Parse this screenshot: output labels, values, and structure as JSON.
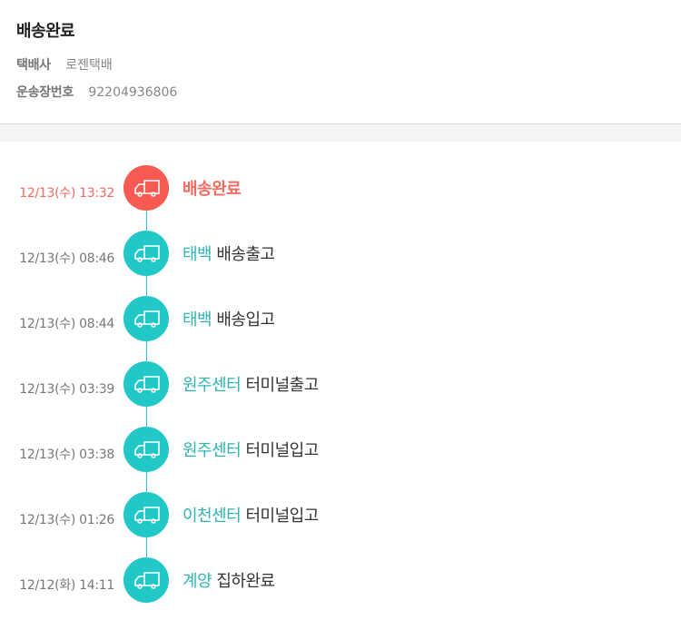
{
  "header": {
    "status_title": "배송완료",
    "courier_label": "택배사",
    "courier_value": "로젠택배",
    "tracking_label": "운송장번호",
    "tracking_value": "92204936806"
  },
  "events": [
    {
      "time": "12/13(수) 13:32",
      "location": "배송완료",
      "desc": "",
      "active": true
    },
    {
      "time": "12/13(수) 08:46",
      "location": "태백",
      "desc": "배송출고",
      "active": false
    },
    {
      "time": "12/13(수) 08:44",
      "location": "태백",
      "desc": "배송입고",
      "active": false
    },
    {
      "time": "12/13(수) 03:39",
      "location": "원주센터",
      "desc": "터미널출고",
      "active": false
    },
    {
      "time": "12/13(수) 03:38",
      "location": "원주센터",
      "desc": "터미널입고",
      "active": false
    },
    {
      "time": "12/13(수) 01:26",
      "location": "이천센터",
      "desc": "터미널입고",
      "active": false
    },
    {
      "time": "12/12(화) 14:11",
      "location": "계양",
      "desc": "집하완료",
      "active": false
    }
  ],
  "icons": {
    "event_icon": "truck-icon"
  },
  "colors": {
    "active": "#f65a50",
    "inactive": "#22c7c7",
    "location_text": "#2fb3b3"
  }
}
